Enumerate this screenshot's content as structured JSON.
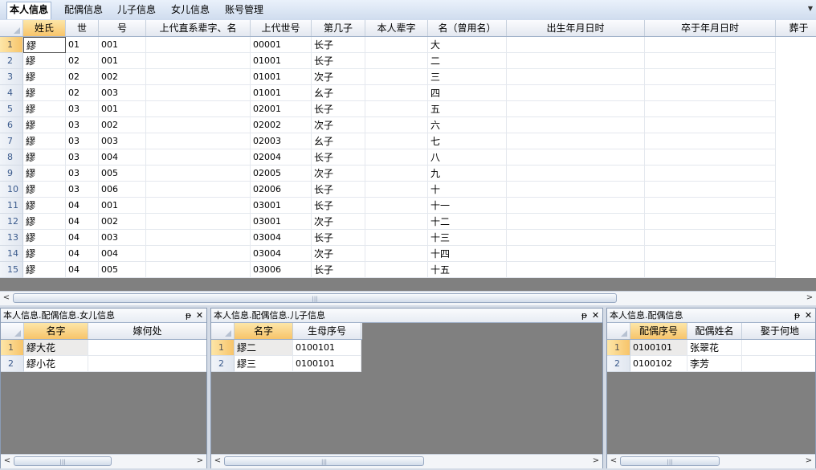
{
  "tabs": [
    "本人信息",
    "配偶信息",
    "儿子信息",
    "女儿信息",
    "账号管理"
  ],
  "tab_menu_icon": "chevron-down-icon",
  "main_grid": {
    "columns": [
      "姓氏",
      "世",
      "号",
      "上代直系辈字、名",
      "上代世号",
      "第几子",
      "本人辈字",
      "名（曾用名）",
      "出生年月日时",
      "卒于年月日时",
      "葬于"
    ],
    "rows": [
      [
        "1",
        "繆",
        "01",
        "001",
        "",
        "00001",
        "长子",
        "",
        "大",
        "",
        ""
      ],
      [
        "2",
        "繆",
        "02",
        "001",
        "",
        "01001",
        "长子",
        "",
        "二",
        "",
        ""
      ],
      [
        "3",
        "繆",
        "02",
        "002",
        "",
        "01001",
        "次子",
        "",
        "三",
        "",
        ""
      ],
      [
        "4",
        "繆",
        "02",
        "003",
        "",
        "01001",
        "幺子",
        "",
        "四",
        "",
        ""
      ],
      [
        "5",
        "繆",
        "03",
        "001",
        "",
        "02001",
        "长子",
        "",
        "五",
        "",
        ""
      ],
      [
        "6",
        "繆",
        "03",
        "002",
        "",
        "02002",
        "次子",
        "",
        "六",
        "",
        ""
      ],
      [
        "7",
        "繆",
        "03",
        "003",
        "",
        "02003",
        "幺子",
        "",
        "七",
        "",
        ""
      ],
      [
        "8",
        "繆",
        "03",
        "004",
        "",
        "02004",
        "长子",
        "",
        "八",
        "",
        ""
      ],
      [
        "9",
        "繆",
        "03",
        "005",
        "",
        "02005",
        "次子",
        "",
        "九",
        "",
        ""
      ],
      [
        "10",
        "繆",
        "03",
        "006",
        "",
        "02006",
        "长子",
        "",
        "十",
        "",
        ""
      ],
      [
        "11",
        "繆",
        "04",
        "001",
        "",
        "03001",
        "长子",
        "",
        "十一",
        "",
        ""
      ],
      [
        "12",
        "繆",
        "04",
        "002",
        "",
        "03001",
        "次子",
        "",
        "十二",
        "",
        ""
      ],
      [
        "13",
        "繆",
        "04",
        "003",
        "",
        "03004",
        "长子",
        "",
        "十三",
        "",
        ""
      ],
      [
        "14",
        "繆",
        "04",
        "004",
        "",
        "03004",
        "次子",
        "",
        "十四",
        "",
        ""
      ],
      [
        "15",
        "繆",
        "04",
        "005",
        "",
        "03006",
        "长子",
        "",
        "十五",
        "",
        ""
      ]
    ]
  },
  "panels": {
    "daughters": {
      "title": "本人信息.配偶信息.女儿信息",
      "columns": [
        "名字",
        "嫁何处"
      ],
      "rows": [
        [
          "1",
          "繆大花",
          ""
        ],
        [
          "2",
          "繆小花",
          ""
        ]
      ]
    },
    "sons": {
      "title": "本人信息.配偶信息.儿子信息",
      "columns": [
        "名字",
        "生母序号"
      ],
      "rows": [
        [
          "1",
          "繆二",
          "0100101"
        ],
        [
          "2",
          "繆三",
          "0100101"
        ]
      ]
    },
    "spouse": {
      "title": "本人信息.配偶信息",
      "columns": [
        "配偶序号",
        "配偶姓名",
        "娶于何地"
      ],
      "rows": [
        [
          "1",
          "0100101",
          "张翠花",
          ""
        ],
        [
          "2",
          "0100102",
          "李芳",
          ""
        ]
      ]
    }
  },
  "icons": {
    "pin": "pin-icon",
    "close": "close-icon",
    "scroll_left": "arrow-left-icon",
    "scroll_right": "arrow-right-icon"
  },
  "glyphs": {
    "pin": "ᵽ",
    "close": "✕",
    "left": "<",
    "right": ">",
    "grip": "|||"
  }
}
